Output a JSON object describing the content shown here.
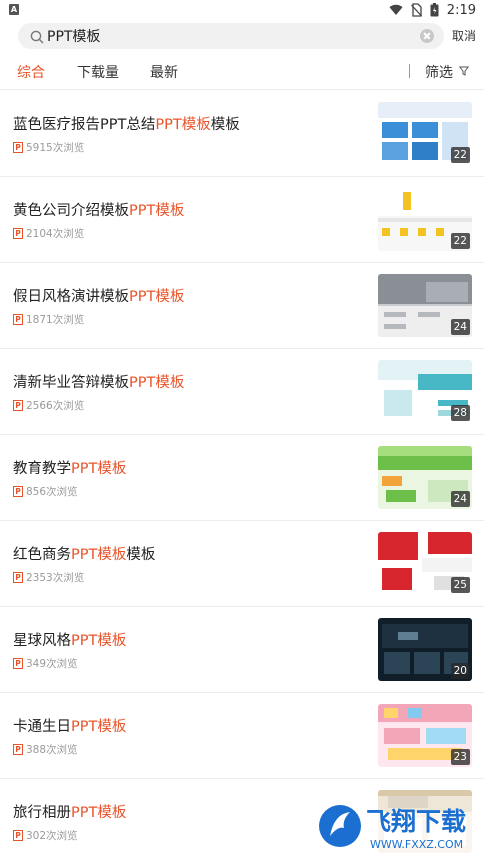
{
  "status_bar": {
    "left_badge": "A",
    "time": "2:19"
  },
  "search": {
    "query": "PPT模板",
    "cancel_label": "取消"
  },
  "tabs": [
    {
      "label": "综合",
      "active": true
    },
    {
      "label": "下载量",
      "active": false
    },
    {
      "label": "最新",
      "active": false
    }
  ],
  "filter": {
    "label": "筛选"
  },
  "results": [
    {
      "title_prefix": "蓝色医疗报告PPT总结",
      "title_highlight": "PPT模板",
      "title_suffix": "模板",
      "views": "5915次浏览",
      "pages": "22",
      "thumb_color": "#3a8fd8"
    },
    {
      "title_prefix": "黄色公司介绍模板",
      "title_highlight": "PPT模板",
      "title_suffix": "",
      "views": "2104次浏览",
      "pages": "22",
      "thumb_color": "#f3c323"
    },
    {
      "title_prefix": "假日风格演讲模板",
      "title_highlight": "PPT模板",
      "title_suffix": "",
      "views": "1871次浏览",
      "pages": "24",
      "thumb_color": "#8a8f96"
    },
    {
      "title_prefix": "清新毕业答辩模板",
      "title_highlight": "PPT模板",
      "title_suffix": "",
      "views": "2566次浏览",
      "pages": "28",
      "thumb_color": "#48b7c6"
    },
    {
      "title_prefix": "教育教学",
      "title_highlight": "PPT模板",
      "title_suffix": "",
      "views": "856次浏览",
      "pages": "24",
      "thumb_color": "#6cc04a"
    },
    {
      "title_prefix": "红色商务",
      "title_highlight": "PPT模板",
      "title_suffix": "模板",
      "views": "2353次浏览",
      "pages": "25",
      "thumb_color": "#d8262e"
    },
    {
      "title_prefix": "星球风格",
      "title_highlight": "PPT模板",
      "title_suffix": "",
      "views": "349次浏览",
      "pages": "20",
      "thumb_color": "#1e3140"
    },
    {
      "title_prefix": "卡通生日",
      "title_highlight": "PPT模板",
      "title_suffix": "",
      "views": "388次浏览",
      "pages": "23",
      "thumb_color": "#f3a6b8"
    },
    {
      "title_prefix": "旅行相册",
      "title_highlight": "PPT模板",
      "title_suffix": "",
      "views": "302次浏览",
      "pages": "",
      "thumb_color": "#d9c9a8"
    }
  ],
  "ppt_icon_letter": "P",
  "watermark": {
    "text": "飞翔下载",
    "url_text": "WWW.FXXZ.COM",
    "color": "#1a6fd1"
  },
  "colors": {
    "accent": "#e8542a",
    "muted": "#9a9a9a"
  }
}
